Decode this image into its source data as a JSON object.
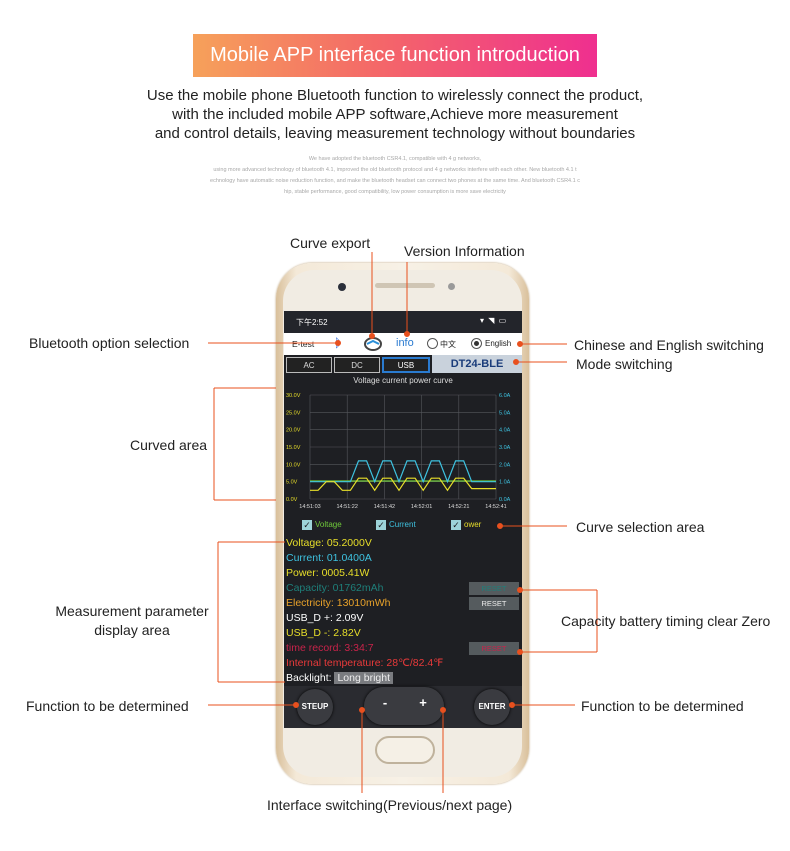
{
  "banner": {
    "title": "Mobile APP interface function introduction",
    "color_start": "#f6a15a",
    "color_end": "#ef2f8f"
  },
  "intro": {
    "line1": "Use the mobile phone Bluetooth function to wirelessly connect the product,",
    "line2": "with the included mobile APP software,Achieve more measurement",
    "line3": "and control details, leaving measurement technology without boundaries"
  },
  "fine_print": {
    "line1": "We have adopted the bluetooth CSR4.1, compatible with 4 g networks,",
    "line2": "using more advanced technology of bluetooth 4.1, improved the old bluetooth protocol and 4 g networks interfere with each other. New bluetooth 4.1 t",
    "line3": "echnology have automatic noise reduction function, and make the bluetooth headset can connect two phones at the same time. And bluetooth CSR4.1 c",
    "line4": "hip, stable performance, good compatibility, low power consumption is more save electricity"
  },
  "callouts": {
    "curve_export": "Curve export",
    "version_info": "Version Information",
    "bluetooth_option": "Bluetooth option selection",
    "lang_switch": "Chinese and English switching",
    "mode_switch": "Mode switching",
    "curved_area": "Curved area",
    "curve_selection": "Curve selection area",
    "measurement_area_1": "Measurement parameter",
    "measurement_area_2": "display area",
    "capacity_clear": "Capacity battery timing clear Zero",
    "func_left": "Function to be determined",
    "func_right": "Function to be determined",
    "interface_switch": "Interface switching(Previous/next page)",
    "line_color": "#e8501e"
  },
  "app": {
    "status": {
      "time": "下午2:52",
      "icons": "▾ ◥ ▭"
    },
    "header": {
      "device": "E-test",
      "info": "info",
      "lang_cn": "中文",
      "lang_en": "English"
    },
    "modes": [
      "AC",
      "DC",
      "USB"
    ],
    "device_name": "DT24-BLE",
    "chart_title": "Voltage current power curve",
    "checkboxes": {
      "voltage": "Voltage",
      "current": "Current",
      "power": "ower"
    },
    "readings": {
      "voltage": "Voltage: 05.2000V",
      "current": "Current: 01.0400A",
      "power": "Power: 0005.41W",
      "capacity": "Capacity: 01762mAh",
      "electricity": "Electricity: 13010mWh",
      "usb_dp": "USB_D +: 2.09V",
      "usb_dm": "USB_D -: 2.82V",
      "time_record": "time record: 3:34:7",
      "internal_temp": "Internal temperature: 28℃/82.4℉",
      "backlight_label": "Backlight:",
      "backlight_value": "Long bright"
    },
    "reset_buttons": {
      "capacity": "RESET",
      "electricity": "RESET",
      "time": "RESET"
    },
    "buttons": {
      "setup": "STEUP",
      "minus": "-",
      "plus": "+",
      "enter": "ENTER"
    }
  },
  "chart_data": {
    "type": "line",
    "title": "Voltage current power curve",
    "x_ticks": [
      "14:51:03",
      "14:51:22",
      "14:51:42",
      "14:52:01",
      "14:52:21",
      "14:52:41"
    ],
    "y_left_ticks": [
      "0.0V",
      "5.0V",
      "10.0V",
      "15.0V",
      "20.0V",
      "25.0V",
      "30.0V"
    ],
    "y_right_ticks": [
      "0.0A",
      "1.0A",
      "2.0A",
      "3.0A",
      "4.0A",
      "5.0A",
      "6.0A"
    ],
    "ylim_left": [
      0,
      30
    ],
    "ylim_right": [
      0,
      6
    ],
    "grid": true,
    "series": [
      {
        "name": "Voltage",
        "color": "#6fc93a",
        "values": [
          5.2,
          5.2,
          5.2,
          5.2,
          5.2,
          5.2,
          5.2,
          5.2,
          5.2,
          5.2,
          5.2,
          5.2,
          5.2,
          5.2,
          5.2,
          5.2,
          5.2,
          5.2,
          5.2,
          5.2,
          5.2,
          5.2,
          5.2,
          5.2
        ]
      },
      {
        "name": "Current",
        "color": "#3ec2e0",
        "values": [
          1.0,
          1.0,
          1.0,
          1.0,
          1.0,
          1.0,
          2.2,
          2.2,
          1.0,
          2.2,
          2.2,
          1.0,
          2.2,
          2.2,
          1.0,
          2.2,
          2.2,
          1.0,
          2.2,
          2.2,
          1.0,
          1.0,
          1.0,
          1.0
        ]
      },
      {
        "name": "ower",
        "color": "#e8df2a",
        "values": [
          0.5,
          0.5,
          1.0,
          1.0,
          0.5,
          0.5,
          1.2,
          1.2,
          0.5,
          1.2,
          1.2,
          0.5,
          1.2,
          1.2,
          0.5,
          1.2,
          1.2,
          0.5,
          1.2,
          1.2,
          0.6,
          0.6,
          0.6,
          0.6
        ]
      }
    ]
  }
}
